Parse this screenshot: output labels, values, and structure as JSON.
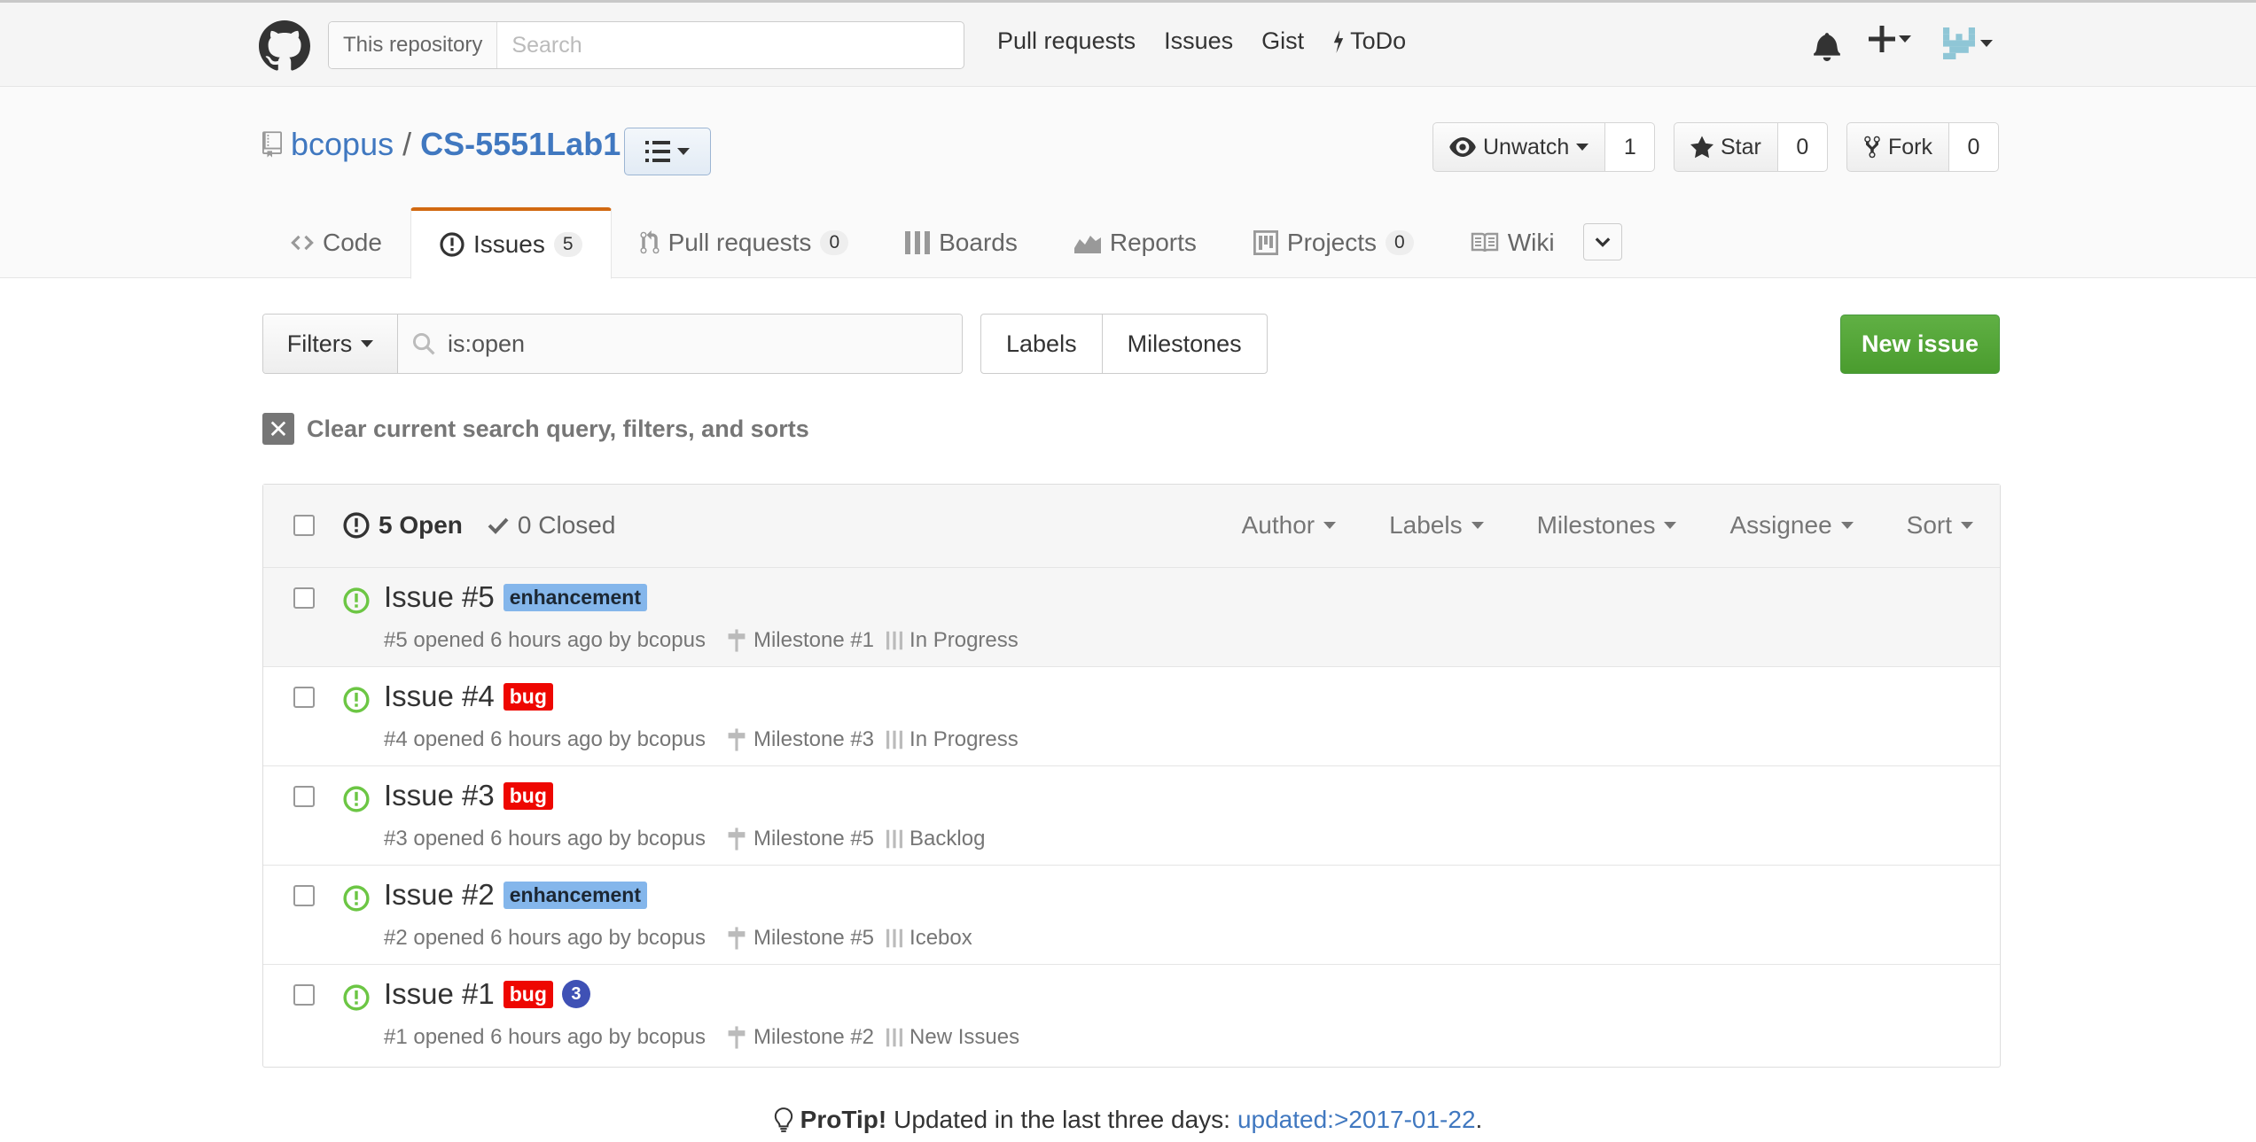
{
  "header": {
    "scope_label": "This repository",
    "search_placeholder": "Search",
    "nav": [
      "Pull requests",
      "Issues",
      "Gist",
      "ToDo"
    ]
  },
  "repo": {
    "owner": "bcopus",
    "separator": "/",
    "name": "CS-5551Lab1",
    "watch": {
      "label": "Unwatch",
      "count": "1"
    },
    "star": {
      "label": "Star",
      "count": "0"
    },
    "fork": {
      "label": "Fork",
      "count": "0"
    }
  },
  "tabs": [
    {
      "label": "Code",
      "count": null,
      "icon": "code-icon"
    },
    {
      "label": "Issues",
      "count": "5",
      "icon": "issue-opened-icon"
    },
    {
      "label": "Pull requests",
      "count": "0",
      "icon": "git-pull-request-icon"
    },
    {
      "label": "Boards",
      "count": null,
      "icon": "boards-icon"
    },
    {
      "label": "Reports",
      "count": null,
      "icon": "graph-icon"
    },
    {
      "label": "Projects",
      "count": "0",
      "icon": "project-icon"
    },
    {
      "label": "Wiki",
      "count": null,
      "icon": "book-icon"
    }
  ],
  "toolbar": {
    "filters_label": "Filters",
    "filter_query": "is:open",
    "labels_label": "Labels",
    "milestones_label": "Milestones",
    "new_issue_label": "New issue",
    "clear_label": "Clear current search query, filters, and sorts"
  },
  "list_header": {
    "open_label": "5 Open",
    "closed_label": "0 Closed",
    "sort_menus": [
      "Author",
      "Labels",
      "Milestones",
      "Assignee",
      "Sort"
    ]
  },
  "issues": [
    {
      "title": "Issue #5",
      "labels": [
        {
          "name": "enhancement",
          "color": "#84b6eb"
        }
      ],
      "comments": null,
      "meta": "#5 opened 6 hours ago by bcopus",
      "milestone": "Milestone #1",
      "stage": "In Progress"
    },
    {
      "title": "Issue #4",
      "labels": [
        {
          "name": "bug",
          "color": "#ee0701"
        }
      ],
      "comments": null,
      "meta": "#4 opened 6 hours ago by bcopus",
      "milestone": "Milestone #3",
      "stage": "In Progress"
    },
    {
      "title": "Issue #3",
      "labels": [
        {
          "name": "bug",
          "color": "#ee0701"
        }
      ],
      "comments": null,
      "meta": "#3 opened 6 hours ago by bcopus",
      "milestone": "Milestone #5",
      "stage": "Backlog"
    },
    {
      "title": "Issue #2",
      "labels": [
        {
          "name": "enhancement",
          "color": "#84b6eb"
        }
      ],
      "comments": null,
      "meta": "#2 opened 6 hours ago by bcopus",
      "milestone": "Milestone #5",
      "stage": "Icebox"
    },
    {
      "title": "Issue #1",
      "labels": [
        {
          "name": "bug",
          "color": "#ee0701"
        }
      ],
      "comments": "3",
      "meta": "#1 opened 6 hours ago by bcopus",
      "milestone": "Milestone #2",
      "stage": "New Issues"
    }
  ],
  "protip": {
    "strong": "ProTip!",
    "text": "Updated in the last three days:",
    "link": "updated:>2017-01-22",
    "trailing": "."
  },
  "colors": {
    "link": "#4078c0",
    "new_issue_green": "#60b044",
    "tab_accent": "#d26911",
    "open_issue_green": "#6cc644"
  }
}
